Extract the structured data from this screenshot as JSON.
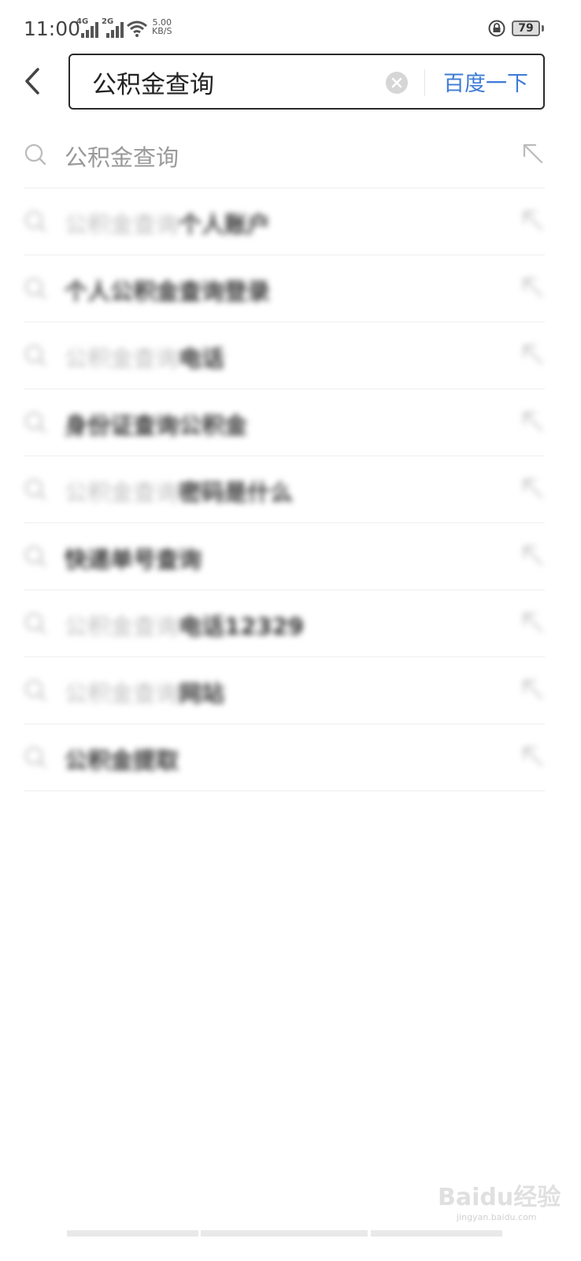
{
  "status_bar": {
    "time": "11:00",
    "network_1": "4G",
    "network_2": "2G",
    "speed_value": "5.00",
    "speed_unit": "KB/S",
    "battery": "79"
  },
  "search": {
    "query": "公积金查询",
    "submit_label": "百度一下"
  },
  "suggestions": [
    {
      "prefix": "公积金查询",
      "rest": "",
      "blurred": false
    },
    {
      "prefix": "公积金查询",
      "rest": "个人账户",
      "blurred": true
    },
    {
      "prefix": "",
      "rest": "个人公积金查询登录",
      "blurred": true
    },
    {
      "prefix": "公积金查询",
      "rest": "电话",
      "blurred": true
    },
    {
      "prefix": "",
      "rest": "身份证查询公积金",
      "blurred": true
    },
    {
      "prefix": "公积金查询",
      "rest": "密码是什么",
      "blurred": true
    },
    {
      "prefix": "",
      "rest": "快递单号查询",
      "blurred": true
    },
    {
      "prefix": "公积金查询",
      "rest": "电话12329",
      "blurred": true
    },
    {
      "prefix": "公积金查询",
      "rest": "网站",
      "blurred": true
    },
    {
      "prefix": "",
      "rest": "公积金提取",
      "blurred": true
    }
  ],
  "watermark": {
    "brand": "Baidu经验",
    "domain": "jingyan.baidu.com"
  },
  "colors": {
    "accent": "#3d7bd6",
    "border": "#2a2a2a",
    "muted_text": "#999999"
  }
}
